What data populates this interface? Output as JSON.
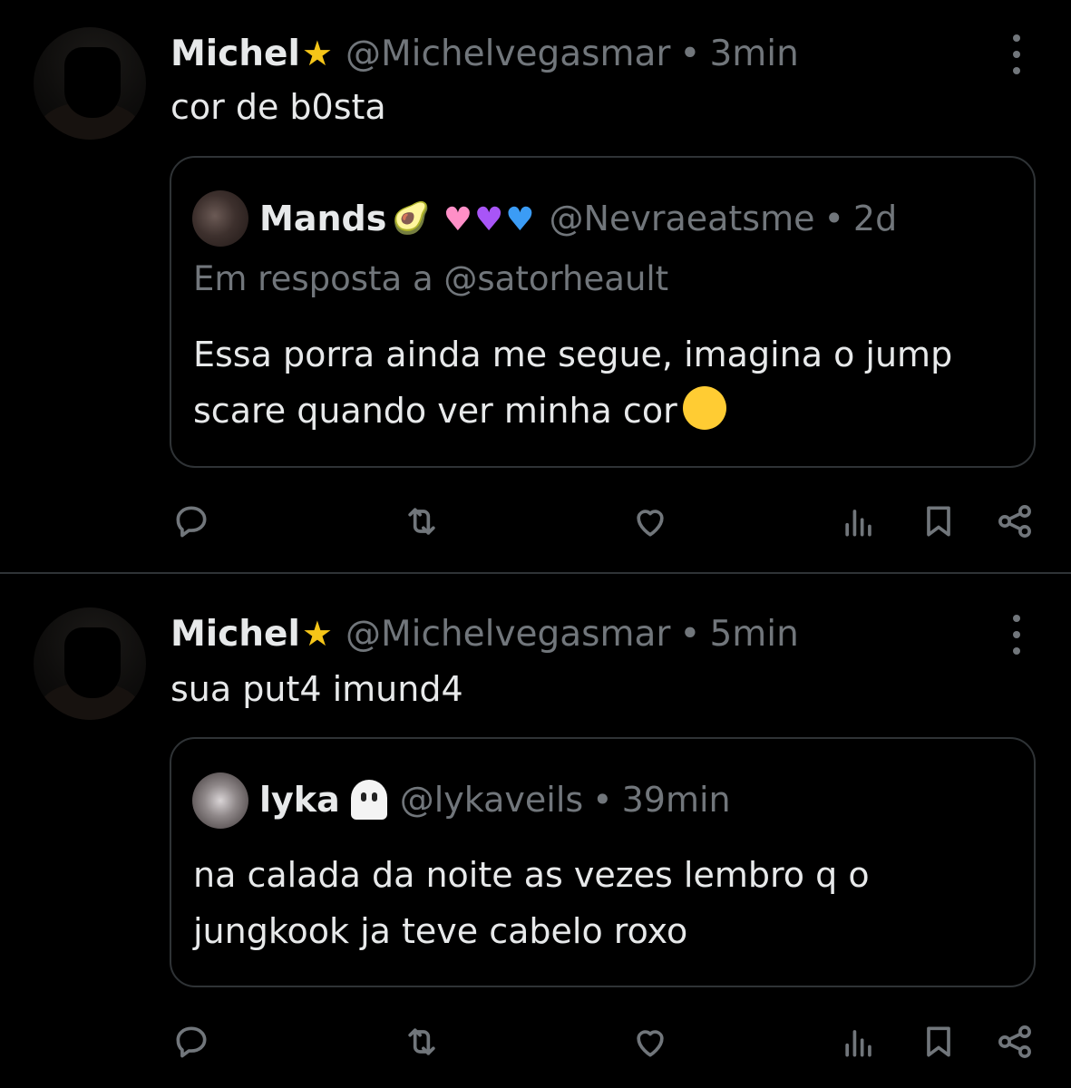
{
  "tweets": [
    {
      "author": {
        "name": "Michel",
        "handle": "@Michelvegasmar"
      },
      "separator": "•",
      "time": "3min",
      "text": "cor de b0sta",
      "quote": {
        "author": {
          "name": "Mands",
          "handle": "@Nevraeatsme"
        },
        "separator": "•",
        "time": "2d",
        "reply_to": "Em resposta a @satorheault",
        "text": "Essa porra ainda me segue, imagina o jump scare quando ver minha cor"
      }
    },
    {
      "author": {
        "name": "Michel",
        "handle": "@Michelvegasmar"
      },
      "separator": "•",
      "time": "5min",
      "text": "sua put4 imund4",
      "quote": {
        "author": {
          "name": "lyka",
          "handle": "@lykaveils"
        },
        "separator": "•",
        "time": "39min",
        "text": "na calada da noite as vezes lembro q o jungkook ja teve cabelo roxo"
      }
    }
  ],
  "icons": {
    "star": "star-icon",
    "avocado": "avocado-icon",
    "hearts": [
      "pink-heart-icon",
      "purple-heart-icon",
      "blue-heart-icon"
    ],
    "heart_eyes": "heart-eyes-emoji-icon",
    "ghost": "ghost-icon",
    "actions": [
      "reply-icon",
      "retweet-icon",
      "like-icon",
      "views-icon",
      "bookmark-icon",
      "share-icon"
    ]
  },
  "colors": {
    "background": "#000000",
    "text": "#e7e9ea",
    "muted": "#71767b",
    "border": "#2f3336",
    "star": "#f5c518"
  }
}
